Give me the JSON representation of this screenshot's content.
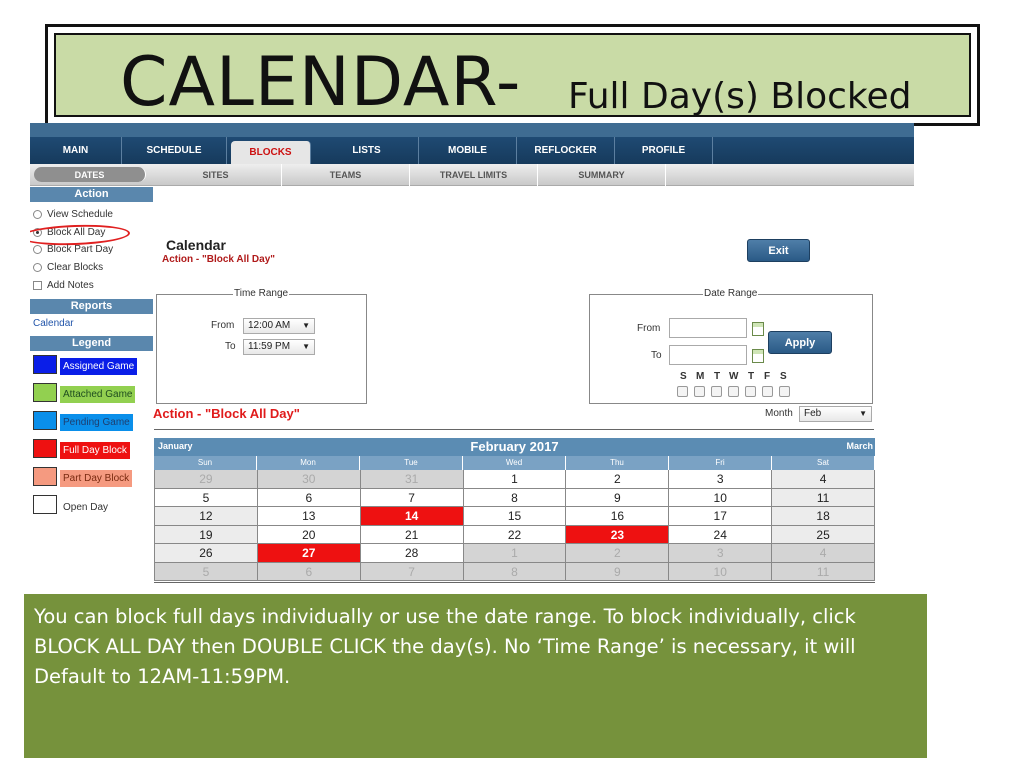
{
  "slide": {
    "title_big": "CALENDAR-",
    "title_small": "Full Day(s) Blocked",
    "caption": "You can block full days individually or use the date range.  To block individually, click BLOCK ALL DAY then DOUBLE CLICK the  day(s).   No ‘Time Range’ is necessary, it will Default to 12AM-11:59PM."
  },
  "nav": {
    "tabs": [
      "MAIN",
      "SCHEDULE",
      "BLOCKS",
      "LISTS",
      "MOBILE",
      "REFLOCKER",
      "PROFILE"
    ],
    "active": "BLOCKS"
  },
  "subnav": {
    "tabs": [
      "DATES",
      "SITES",
      "TEAMS",
      "TRAVEL LIMITS",
      "SUMMARY"
    ],
    "active": "DATES"
  },
  "sidebar": {
    "action_header": "Action",
    "actions": [
      "View Schedule",
      "Block All Day",
      "Block Part Day",
      "Clear Blocks"
    ],
    "selected_action": "Block All Day",
    "add_notes": "Add Notes",
    "reports_header": "Reports",
    "reports_link": "Calendar",
    "legend_header": "Legend",
    "legend": [
      {
        "label": "Assigned Game",
        "color": "#0a1ee8",
        "text_color": "#ffffff"
      },
      {
        "label": "Attached Game",
        "color": "#92d050",
        "text_color": "#1f4d1f"
      },
      {
        "label": "Pending Game",
        "color": "#0a8fea",
        "text_color": "#1e3f70"
      },
      {
        "label": "Full Day Block",
        "color": "#ee1111",
        "text_color": "#ffffff"
      },
      {
        "label": "Part Day Block",
        "color": "#f59a80",
        "text_color": "#7a2a10"
      },
      {
        "label": "Open Day",
        "color": "#ffffff",
        "text_color": "#333333"
      }
    ]
  },
  "main": {
    "title": "Calendar",
    "subtitle": "Action - \"Block All Day\"",
    "exit_label": "Exit",
    "time_range": {
      "legend": "Time Range",
      "from_label": "From",
      "from_value": "12:00 AM",
      "to_label": "To",
      "to_value": "11:59 PM"
    },
    "date_range": {
      "legend": "Date Range",
      "from_label": "From",
      "to_label": "To",
      "apply_label": "Apply",
      "weekdays": [
        "S",
        "M",
        "T",
        "W",
        "T",
        "F",
        "S"
      ]
    },
    "action_banner": "Action - \"Block All Day\"",
    "month_label": "Month",
    "month_value": "Feb"
  },
  "calendar": {
    "prev": "January",
    "title": "February 2017",
    "next": "March",
    "day_headers": [
      "Sun",
      "Mon",
      "Tue",
      "Wed",
      "Thu",
      "Fri",
      "Sat"
    ],
    "weeks": [
      [
        {
          "d": "29",
          "t": "other"
        },
        {
          "d": "30",
          "t": "other"
        },
        {
          "d": "31",
          "t": "other"
        },
        {
          "d": "1"
        },
        {
          "d": "2"
        },
        {
          "d": "3"
        },
        {
          "d": "4",
          "t": "wkend"
        }
      ],
      [
        {
          "d": "5"
        },
        {
          "d": "6"
        },
        {
          "d": "7"
        },
        {
          "d": "8"
        },
        {
          "d": "9"
        },
        {
          "d": "10"
        },
        {
          "d": "11",
          "t": "wkend"
        }
      ],
      [
        {
          "d": "12",
          "t": "wkend"
        },
        {
          "d": "13"
        },
        {
          "d": "14",
          "t": "full"
        },
        {
          "d": "15"
        },
        {
          "d": "16"
        },
        {
          "d": "17"
        },
        {
          "d": "18",
          "t": "wkend"
        }
      ],
      [
        {
          "d": "19",
          "t": "wkend"
        },
        {
          "d": "20"
        },
        {
          "d": "21"
        },
        {
          "d": "22"
        },
        {
          "d": "23",
          "t": "full"
        },
        {
          "d": "24"
        },
        {
          "d": "25",
          "t": "wkend"
        }
      ],
      [
        {
          "d": "26",
          "t": "wkend"
        },
        {
          "d": "27",
          "t": "full"
        },
        {
          "d": "28"
        },
        {
          "d": "1",
          "t": "other"
        },
        {
          "d": "2",
          "t": "other"
        },
        {
          "d": "3",
          "t": "other"
        },
        {
          "d": "4",
          "t": "other"
        }
      ],
      [
        {
          "d": "5",
          "t": "other"
        },
        {
          "d": "6",
          "t": "other"
        },
        {
          "d": "7",
          "t": "other"
        },
        {
          "d": "8",
          "t": "other"
        },
        {
          "d": "9",
          "t": "other"
        },
        {
          "d": "10",
          "t": "other"
        },
        {
          "d": "11",
          "t": "other"
        }
      ]
    ]
  }
}
